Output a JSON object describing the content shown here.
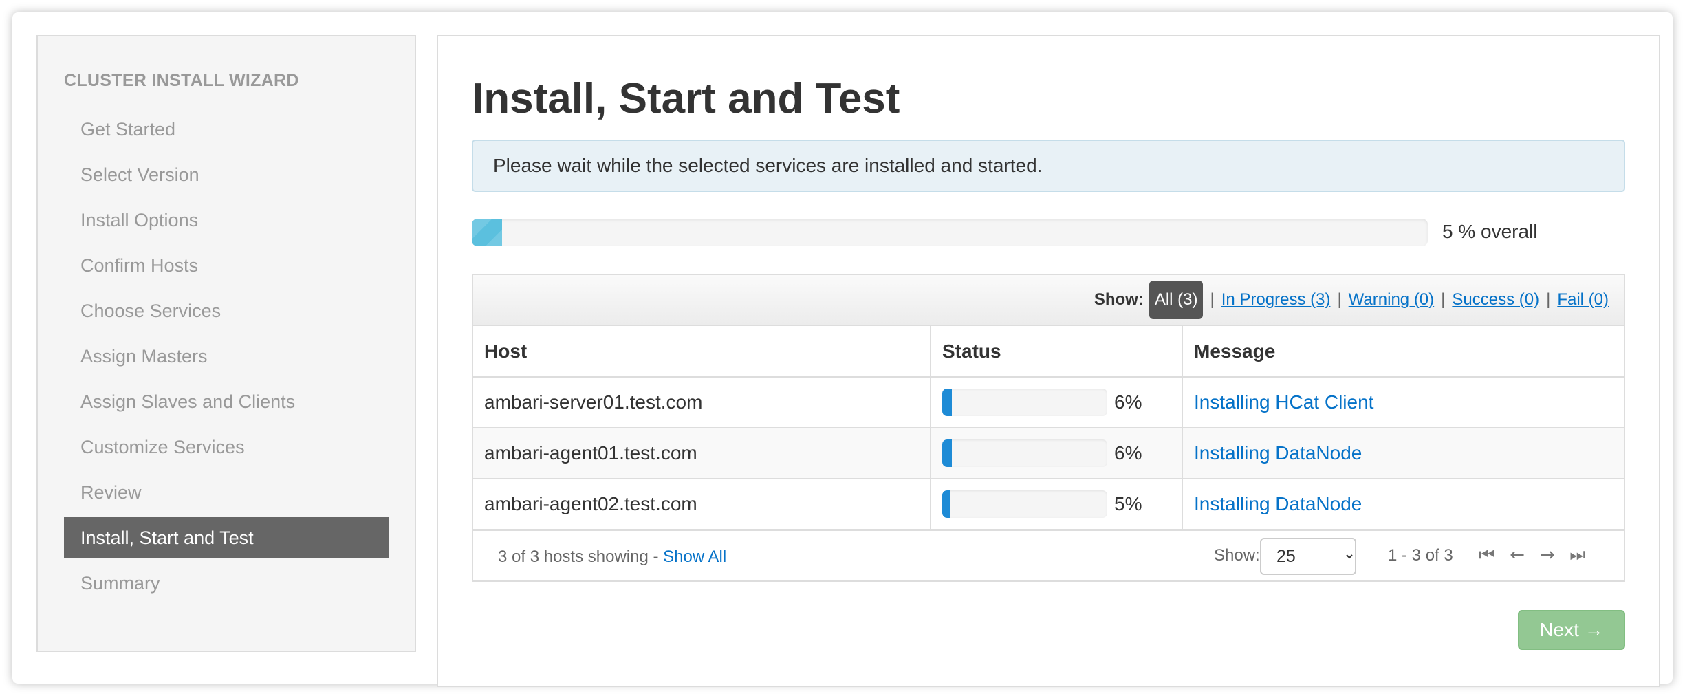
{
  "sidebar": {
    "title": "CLUSTER INSTALL WIZARD",
    "items": [
      {
        "label": "Get Started",
        "active": false
      },
      {
        "label": "Select Version",
        "active": false
      },
      {
        "label": "Install Options",
        "active": false
      },
      {
        "label": "Confirm Hosts",
        "active": false
      },
      {
        "label": "Choose Services",
        "active": false
      },
      {
        "label": "Assign Masters",
        "active": false
      },
      {
        "label": "Assign Slaves and Clients",
        "active": false
      },
      {
        "label": "Customize Services",
        "active": false
      },
      {
        "label": "Review",
        "active": false
      },
      {
        "label": "Install, Start and Test",
        "active": true
      },
      {
        "label": "Summary",
        "active": false
      }
    ]
  },
  "main": {
    "title": "Install, Start and Test",
    "alert": "Please wait while the selected services are installed and started.",
    "overall_progress": 5,
    "overall_text": "5 % overall"
  },
  "filter": {
    "show_label": "Show:",
    "all": "All (3)",
    "in_progress": "In Progress (3)",
    "warning": "Warning (0)",
    "success": "Success (0)",
    "fail": "Fail (0)",
    "separator": "|"
  },
  "table": {
    "headers": {
      "host": "Host",
      "status": "Status",
      "message": "Message"
    },
    "rows": [
      {
        "host": "ambari-server01.test.com",
        "progress": 6,
        "percent": "6%",
        "message": "Installing HCat Client"
      },
      {
        "host": "ambari-agent01.test.com",
        "progress": 6,
        "percent": "6%",
        "message": "Installing DataNode"
      },
      {
        "host": "ambari-agent02.test.com",
        "progress": 5,
        "percent": "5%",
        "message": "Installing DataNode"
      }
    ]
  },
  "footer": {
    "showing": "3 of 3 hosts showing - ",
    "show_all": "Show All",
    "page_size_label": "Show:",
    "page_size": "25",
    "range": "1 - 3 of 3",
    "pager_icons": [
      "first-page-icon",
      "previous-page-icon",
      "next-page-icon",
      "last-page-icon"
    ]
  },
  "next_button": "Next →",
  "colors": {
    "accent_link": "#0572c8",
    "active_nav": "#666666",
    "overall_bar": "#5bc0de",
    "host_bar": "#1e8bd6",
    "next_button": "#93c893"
  }
}
